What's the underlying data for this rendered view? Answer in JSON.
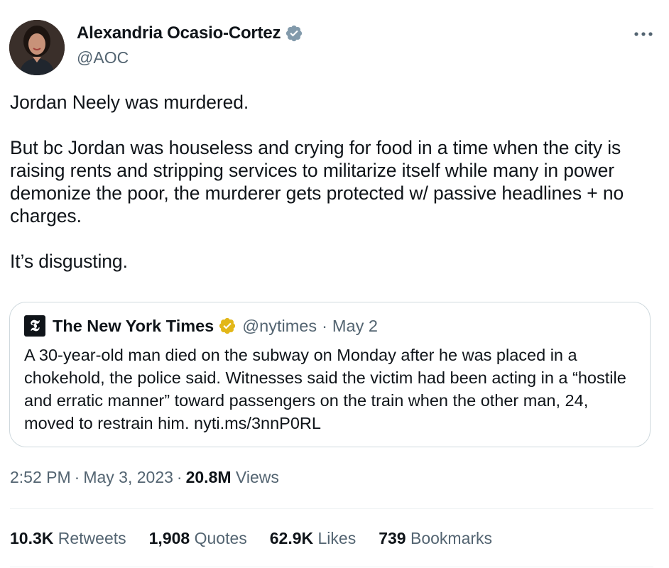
{
  "author": {
    "display_name": "Alexandria Ocasio-Cortez",
    "handle": "@AOC",
    "avatar_icon": "profile-photo",
    "verified_icon": "verified-badge-icon",
    "verified_color": "#829aab"
  },
  "tweet": {
    "paragraphs": [
      "Jordan Neely was murdered.",
      "But bc Jordan was houseless and crying for food in a time when the city is raising rents and stripping services to militarize itself while many in power demonize the poor, the murderer gets protected w/ passive headlines + no charges.",
      "It’s disgusting."
    ]
  },
  "quoted_tweet": {
    "logo_glyph": "𝕿",
    "display_name": "The New York Times",
    "verified_icon": "gold-verified-badge-icon",
    "verified_color": "#e2b719",
    "handle": "@nytimes",
    "dot": "·",
    "date": "May 2",
    "text": "A 30-year-old man died on the subway on Monday after he was placed in a chokehold, the police said. Witnesses said the victim had been acting in a “hostile and erratic manner” toward passengers on the train when the other man, 24, moved to restrain him. nyti.ms/3nnP0RL"
  },
  "meta": {
    "time": "2:52 PM",
    "sep": "·",
    "date": "May 3, 2023",
    "views_count": "20.8M",
    "views_label": "Views"
  },
  "stats": [
    {
      "count": "10.3K",
      "label": "Retweets"
    },
    {
      "count": "1,908",
      "label": "Quotes"
    },
    {
      "count": "62.9K",
      "label": "Likes"
    },
    {
      "count": "739",
      "label": "Bookmarks"
    }
  ],
  "colors": {
    "text": "#0f1419",
    "secondary": "#536471",
    "border": "#cfd9de"
  }
}
